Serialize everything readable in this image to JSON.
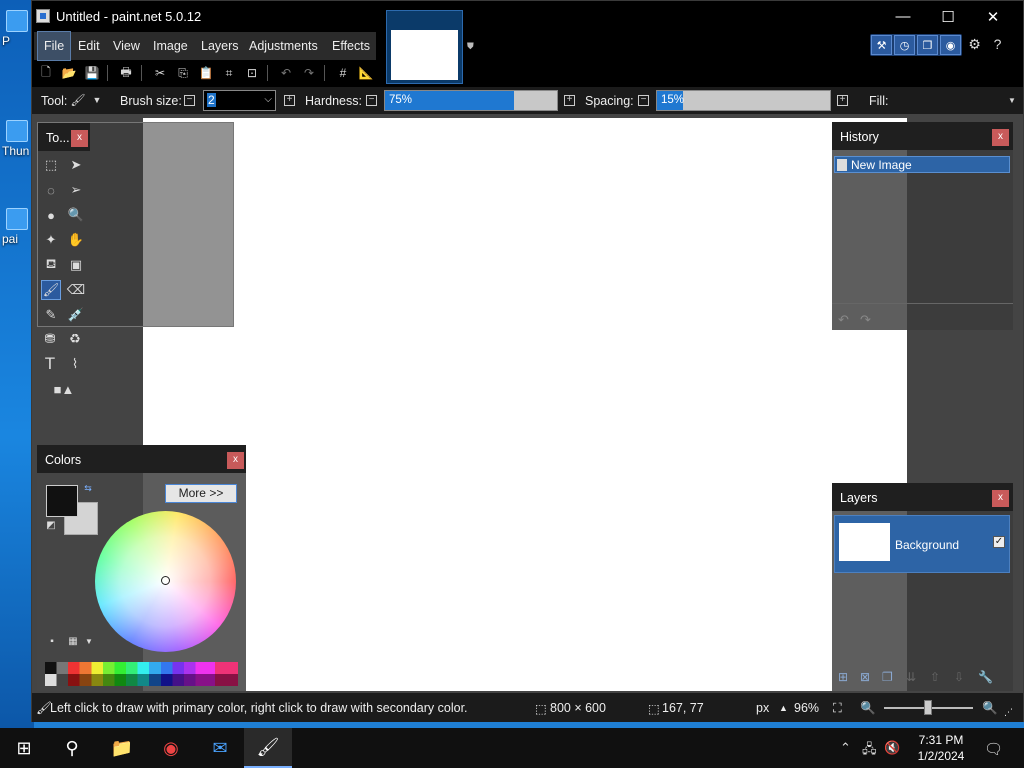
{
  "window": {
    "title": "Untitled - paint.net 5.0.12",
    "minimize": "—",
    "maximize": "☐",
    "close": "✕"
  },
  "menu": {
    "items": [
      "File",
      "Edit",
      "View",
      "Image",
      "Layers",
      "Adjustments",
      "Effects"
    ],
    "active": "File"
  },
  "options": {
    "tool_label": "Tool:",
    "brush_size_label": "Brush size:",
    "brush_size_value": "2",
    "hardness_label": "Hardness:",
    "hardness_value": "75%",
    "hardness_fraction": 0.75,
    "spacing_label": "Spacing:",
    "spacing_value": "15%",
    "spacing_fraction": 0.15,
    "fill_label": "Fill:"
  },
  "tools_panel": {
    "title": "To..."
  },
  "history_panel": {
    "title": "History",
    "items": [
      "New Image"
    ]
  },
  "layers_panel": {
    "title": "Layers",
    "layers": [
      {
        "name": "Background",
        "visible": true
      }
    ]
  },
  "colors_panel": {
    "title": "Colors",
    "more_label": "More >>",
    "primary": "#111111",
    "secondary": "#d4d4d4"
  },
  "status": {
    "hint": "Left click to draw with primary color, right click to draw with secondary color.",
    "image_size": "800 × 600",
    "cursor_pos": "167, 77",
    "units": "px",
    "zoom": "96%"
  },
  "desktop": {
    "icons": [
      "P",
      "Thun",
      "pai"
    ]
  },
  "taskbar": {
    "time": "7:31 PM",
    "date": "1/2/2024"
  },
  "colors": {
    "accent": "#1f78d1",
    "close_red": "#c85a5a"
  }
}
